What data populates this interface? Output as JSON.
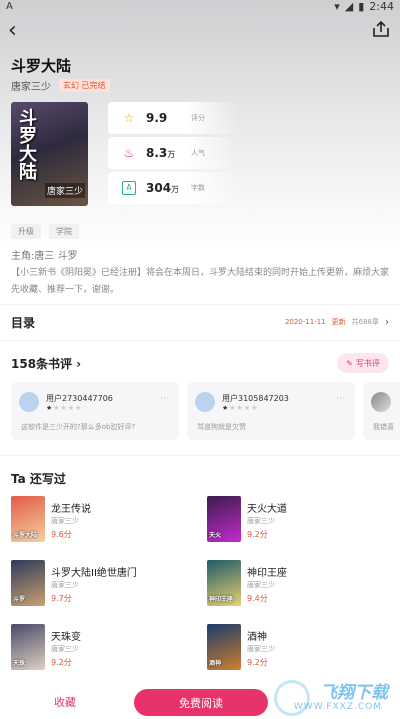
{
  "status": {
    "time": "2:44",
    "indicator": "A"
  },
  "nav": {
    "back_icon": "back-arrow-icon",
    "share_icon": "share-icon"
  },
  "book": {
    "title": "斗罗大陆",
    "author": "唐家三少",
    "tag": "玄幻 已完结",
    "cover_title": "斗罗大陆",
    "cover_author": "唐家三少",
    "stats": [
      {
        "icon": "star-icon",
        "value": "9.9",
        "unit": "",
        "label": "评分",
        "color": "#f0a020"
      },
      {
        "icon": "flame-icon",
        "value": "8.3",
        "unit": "万",
        "label": "人气",
        "color": "#e2386a"
      },
      {
        "icon": "wordcount-icon",
        "value": "304",
        "unit": "万",
        "label": "字数",
        "color": "#2fb07a"
      }
    ],
    "chips": [
      "升级",
      "学院"
    ],
    "lead": "主角:唐三   斗罗",
    "synopsis": "【小三新书《阴阳冕》已经注册】将会在本周日，斗罗大陆结束的同时开始上传更新，麻烦大家先收藏、推荐一下，谢谢。"
  },
  "toc": {
    "title": "目录",
    "date": "2020-11-11",
    "updated": "更新",
    "count": "共688章"
  },
  "reviews": {
    "title": "158条书评",
    "write_label": "写书评",
    "items": [
      {
        "user": "用户2730447706",
        "rating": 1,
        "text": "这软件是三少开的?那么多ob怼好评?"
      },
      {
        "user": "用户3105847203",
        "rating": 1,
        "text": "骂道狗就是欠赞"
      },
      {
        "user": "",
        "rating": 0,
        "text": "我错喜"
      }
    ]
  },
  "other": {
    "title": "Ta 还写过",
    "books": [
      {
        "name": "龙王传说",
        "author": "唐家三少",
        "score": "9.6分",
        "cover_text": "斗罗大陆",
        "c1": "#e25a4a",
        "c2": "#f3d2a0"
      },
      {
        "name": "天火大道",
        "author": "唐家三少",
        "score": "9.2分",
        "cover_text": "天火",
        "c1": "#3b1c4a",
        "c2": "#c22ccf"
      },
      {
        "name": "斗罗大陆II绝世唐门",
        "author": "唐家三少",
        "score": "9.7分",
        "cover_text": "斗罗",
        "c1": "#2e3b5a",
        "c2": "#c9a070"
      },
      {
        "name": "神印王座",
        "author": "唐家三少",
        "score": "9.4分",
        "cover_text": "神印王座",
        "c1": "#1f5a6a",
        "c2": "#e8d070"
      },
      {
        "name": "天珠变",
        "author": "唐家三少",
        "score": "9.2分",
        "cover_text": "天珠",
        "c1": "#4a4a6a",
        "c2": "#e0d0c0"
      },
      {
        "name": "酒神",
        "author": "唐家三少",
        "score": "9.2分",
        "cover_text": "酒神",
        "c1": "#1a3a6a",
        "c2": "#d08030"
      }
    ]
  },
  "bottom": {
    "fav_label": "收藏",
    "read_label": "免费阅读"
  },
  "watermark": {
    "brand": "飞翔下载",
    "url": "WWW.FXXZ.COM"
  }
}
